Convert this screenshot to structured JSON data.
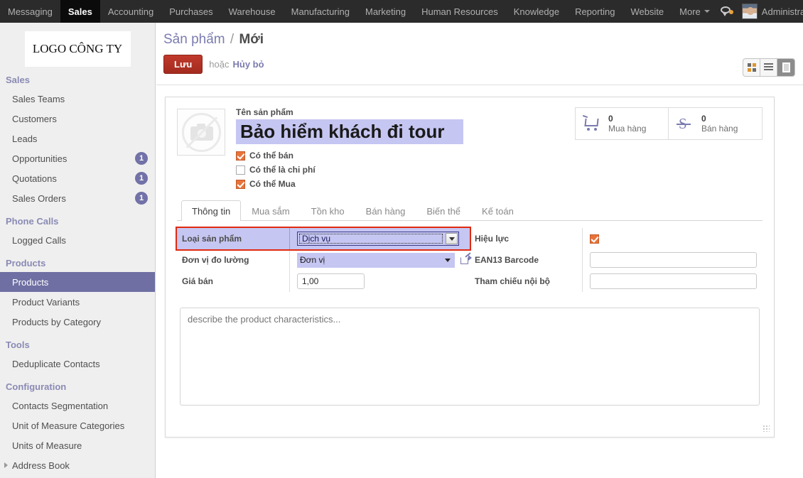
{
  "topbar": {
    "menus": [
      {
        "label": "Messaging",
        "active": false
      },
      {
        "label": "Sales",
        "active": true
      },
      {
        "label": "Accounting",
        "active": false
      },
      {
        "label": "Purchases",
        "active": false
      },
      {
        "label": "Warehouse",
        "active": false
      },
      {
        "label": "Manufacturing",
        "active": false
      },
      {
        "label": "Marketing",
        "active": false
      },
      {
        "label": "Human Resources",
        "active": false
      },
      {
        "label": "Knowledge",
        "active": false
      },
      {
        "label": "Reporting",
        "active": false
      },
      {
        "label": "Website",
        "active": false
      },
      {
        "label": "More",
        "active": false,
        "caret": true
      }
    ],
    "user_name": "Administrator"
  },
  "sidebar": {
    "logo": "LOGO CÔNG TY",
    "groups": [
      {
        "title": "Sales",
        "items": [
          {
            "label": "Sales Teams",
            "badge": "",
            "selected": false
          },
          {
            "label": "Customers",
            "badge": "",
            "selected": false
          },
          {
            "label": "Leads",
            "badge": "",
            "selected": false
          },
          {
            "label": "Opportunities",
            "badge": "1",
            "selected": false
          },
          {
            "label": "Quotations",
            "badge": "1",
            "selected": false
          },
          {
            "label": "Sales Orders",
            "badge": "1",
            "selected": false
          }
        ]
      },
      {
        "title": "Phone Calls",
        "items": [
          {
            "label": "Logged Calls",
            "badge": "",
            "selected": false
          }
        ]
      },
      {
        "title": "Products",
        "items": [
          {
            "label": "Products",
            "badge": "",
            "selected": true
          },
          {
            "label": "Product Variants",
            "badge": "",
            "selected": false
          },
          {
            "label": "Products by Category",
            "badge": "",
            "selected": false
          }
        ]
      },
      {
        "title": "Tools",
        "items": [
          {
            "label": "Deduplicate Contacts",
            "badge": "",
            "selected": false
          }
        ]
      },
      {
        "title": "Configuration",
        "items": [
          {
            "label": "Contacts Segmentation",
            "badge": "",
            "selected": false
          },
          {
            "label": "Unit of Measure Categories",
            "badge": "",
            "selected": false
          },
          {
            "label": "Units of Measure",
            "badge": "",
            "selected": false
          },
          {
            "label": "Address Book",
            "badge": "",
            "selected": false,
            "expandable": true
          }
        ]
      }
    ]
  },
  "control_panel": {
    "breadcrumb_root": "Sản phẩm",
    "breadcrumb_sep": "/",
    "breadcrumb_current": "Mới",
    "save_label": "Lưu",
    "or_label": "hoặc",
    "discard_label": "Hủy bỏ",
    "views": [
      {
        "name": "kanban",
        "active": false
      },
      {
        "name": "list",
        "active": false
      },
      {
        "name": "form",
        "active": true
      }
    ]
  },
  "form": {
    "product_name_label": "Tên sản phẩm",
    "product_name_value": "Bảo hiểm khách đi tour",
    "checkboxes": [
      {
        "label": "Có thể bán",
        "checked": true
      },
      {
        "label": "Có thể là chi phí",
        "checked": false
      },
      {
        "label": "Có thể Mua",
        "checked": true
      }
    ],
    "stat_buttons": [
      {
        "icon": "cart-icon",
        "value": "0",
        "label": "Mua hàng"
      },
      {
        "icon": "sales-s-icon",
        "value": "0",
        "label": "Bán hàng"
      }
    ],
    "tabs": [
      {
        "label": "Thông tin",
        "active": true
      },
      {
        "label": "Mua sắm",
        "active": false
      },
      {
        "label": "Tồn kho",
        "active": false
      },
      {
        "label": "Bán hàng",
        "active": false
      },
      {
        "label": "Biến thể",
        "active": false
      },
      {
        "label": "Kế toán",
        "active": false
      }
    ],
    "left_fields": {
      "product_type_label": "Loại sản phẩm",
      "product_type_value": "Dịch vụ",
      "uom_label": "Đơn vị đo lường",
      "uom_value": "Đơn vị",
      "price_label": "Giá bán",
      "price_value": "1,00"
    },
    "right_fields": {
      "active_label": "Hiệu lực",
      "active_checked": true,
      "ean13_label": "EAN13 Barcode",
      "ean13_value": "",
      "internal_ref_label": "Tham chiếu nội bộ",
      "internal_ref_value": ""
    },
    "description_placeholder": "describe the product characteristics..."
  },
  "colors": {
    "accent_purple": "#7b7bb0",
    "highlight_lavender": "#c6c6f2",
    "alert_red": "#e02a10",
    "save_red": "#b3301f",
    "checkbox_orange": "#e8743b",
    "sidebar_selected": "#6f6fa3"
  }
}
